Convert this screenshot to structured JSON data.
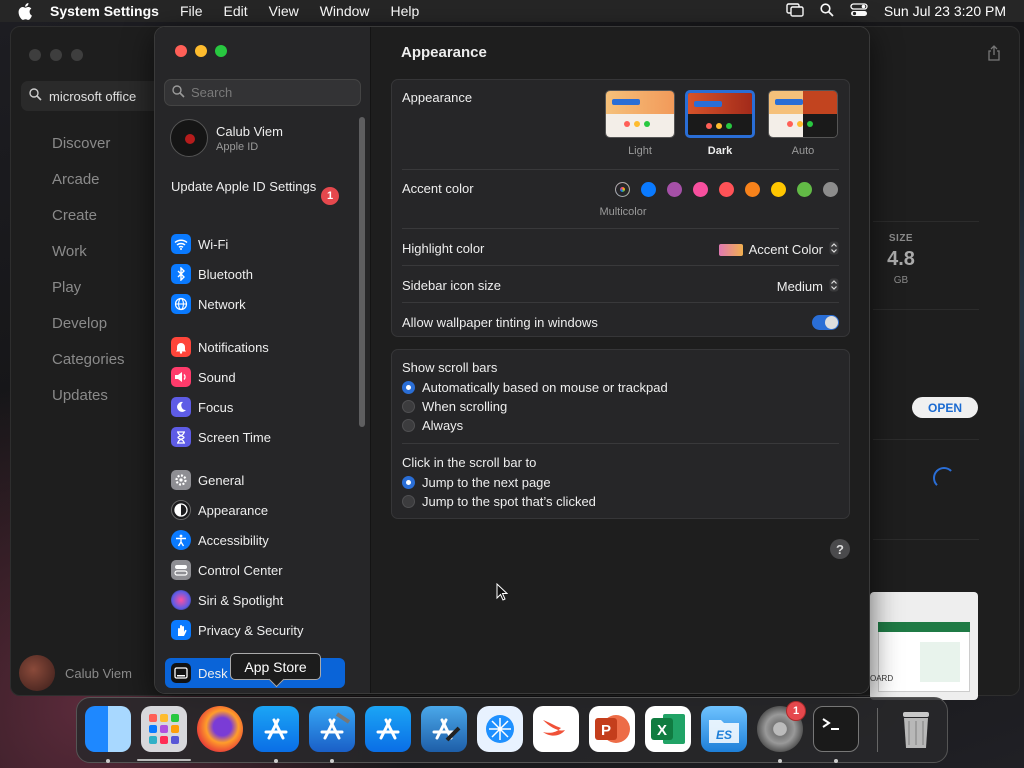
{
  "menubar": {
    "app_name": "System Settings",
    "menus": [
      "File",
      "Edit",
      "View",
      "Window",
      "Help"
    ],
    "clock": "Sun Jul 23  3:20 PM"
  },
  "app_store": {
    "search_value": "microsoft office",
    "nav": [
      "Discover",
      "Arcade",
      "Create",
      "Work",
      "Play",
      "Develop",
      "Categories",
      "Updates"
    ],
    "user_name": "Calub Viem",
    "size_label": "SIZE",
    "size_value": "4.8",
    "size_unit": "GB",
    "open_label": "OPEN",
    "thumb_text": "OARD"
  },
  "settings": {
    "search_placeholder": "Search",
    "profile": {
      "name": "Calub Viem",
      "subtitle": "Apple ID"
    },
    "update_notice": "Update Apple ID Settings",
    "update_badge": "1",
    "sidebar_items": [
      {
        "label": "Wi-Fi",
        "icon": "wifi-icon"
      },
      {
        "label": "Bluetooth",
        "icon": "bluetooth-icon"
      },
      {
        "label": "Network",
        "icon": "globe-icon"
      },
      {
        "label": "Notifications",
        "icon": "bell-icon"
      },
      {
        "label": "Sound",
        "icon": "speaker-icon"
      },
      {
        "label": "Focus",
        "icon": "moon-icon"
      },
      {
        "label": "Screen Time",
        "icon": "hourglass-icon"
      },
      {
        "label": "General",
        "icon": "gear-icon"
      },
      {
        "label": "Appearance",
        "icon": "appearance-icon"
      },
      {
        "label": "Accessibility",
        "icon": "accessibility-icon"
      },
      {
        "label": "Control Center",
        "icon": "control-center-icon"
      },
      {
        "label": "Siri & Spotlight",
        "icon": "siri-icon"
      },
      {
        "label": "Privacy & Security",
        "icon": "hand-icon"
      },
      {
        "label": "Desk",
        "icon": "desktop-icon"
      }
    ],
    "tooltip": "App Store",
    "page_title": "Appearance",
    "appearance_label": "Appearance",
    "appearance_options": [
      {
        "label": "Light",
        "selected": false
      },
      {
        "label": "Dark",
        "selected": true
      },
      {
        "label": "Auto",
        "selected": false
      }
    ],
    "accent_label": "Accent color",
    "accent_selected_name": "Multicolor",
    "accent_colors": [
      "#8e44ad",
      "#0a7aff",
      "#a550a7",
      "#f74f9e",
      "#ff5257",
      "#f7821b",
      "#ffc600",
      "#62ba46",
      "#8c8c8c"
    ],
    "highlight_label": "Highlight color",
    "highlight_value": "Accent Color",
    "sidebar_icon_label": "Sidebar icon size",
    "sidebar_icon_value": "Medium",
    "wallpaper_tint_label": "Allow wallpaper tinting in windows",
    "wallpaper_tint_on": true,
    "scroll_bars_label": "Show scroll bars",
    "scroll_bar_options": [
      {
        "label": "Automatically based on mouse or trackpad",
        "selected": true
      },
      {
        "label": "When scrolling",
        "selected": false
      },
      {
        "label": "Always",
        "selected": false
      }
    ],
    "click_label": "Click in the scroll bar to",
    "click_options": [
      {
        "label": "Jump to the next page",
        "selected": true
      },
      {
        "label": "Jump to the spot that’s clicked",
        "selected": false
      }
    ],
    "help_label": "?"
  },
  "dock": {
    "badge": "1",
    "apps": [
      "finder-icon",
      "launchpad-icon",
      "firefox-icon",
      "app-store-icon",
      "xcode-icon",
      "app-store-icon",
      "xcode-icon",
      "instruments-icon",
      "swift-icon",
      "powerpoint-icon",
      "excel-icon",
      "es-file-explorer-icon",
      "system-settings-icon",
      "terminal-icon",
      "trash-icon"
    ]
  }
}
